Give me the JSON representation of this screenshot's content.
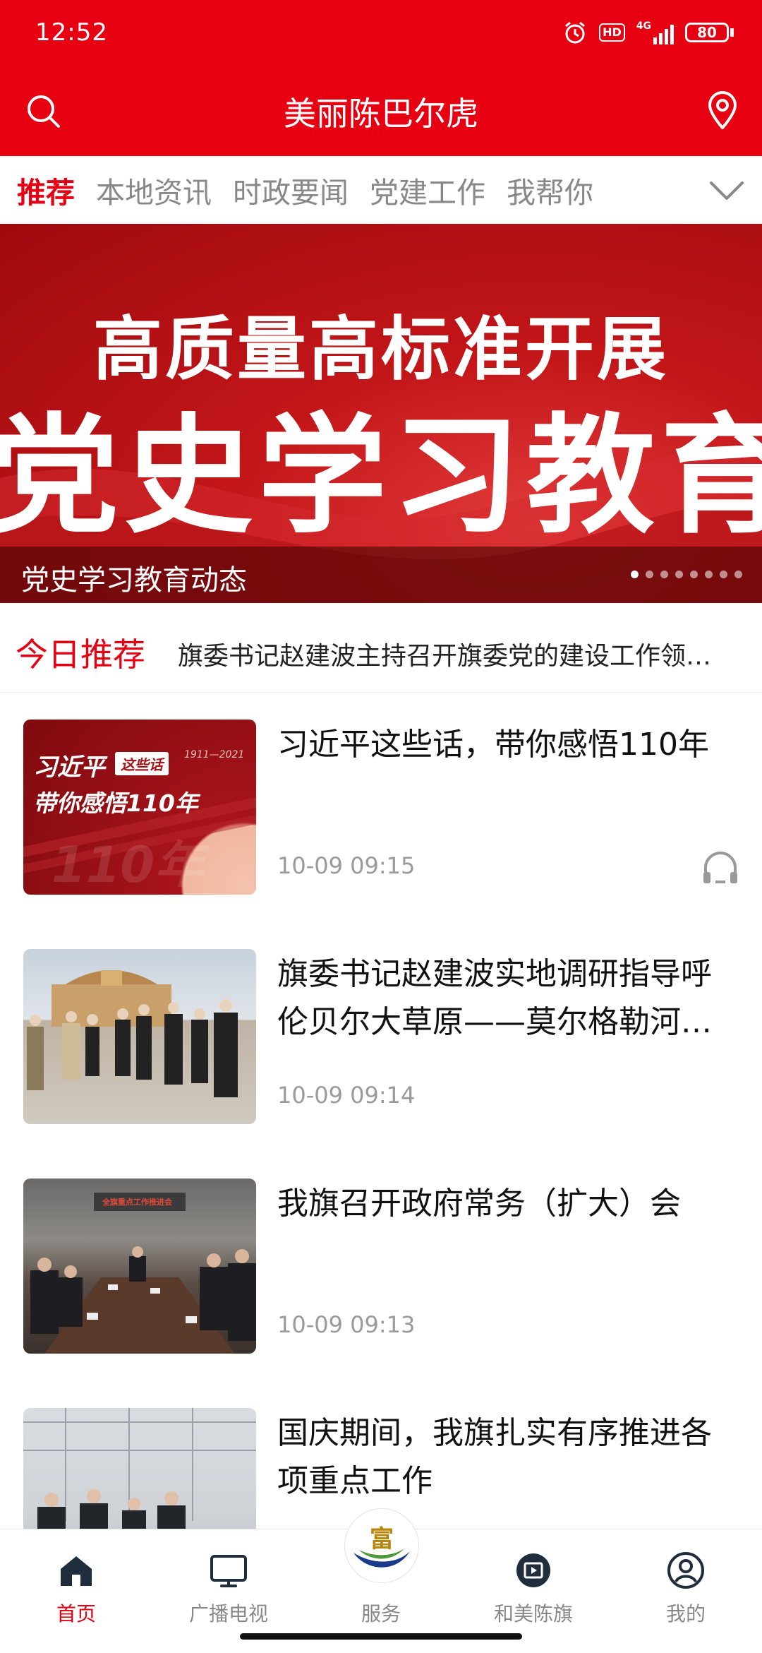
{
  "status_bar": {
    "time": "12:52",
    "network": "4G",
    "hd": "HD",
    "battery": "80"
  },
  "header": {
    "title": "美丽陈巴尔虎"
  },
  "tabs": [
    {
      "label": "推荐",
      "active": true
    },
    {
      "label": "本地资讯",
      "active": false
    },
    {
      "label": "时政要闻",
      "active": false
    },
    {
      "label": "党建工作",
      "active": false
    },
    {
      "label": "我帮你",
      "active": false
    }
  ],
  "banner": {
    "line1": "高质量高标准开展",
    "line2": "党史学习教育",
    "caption": "党史学习教育动态",
    "slide_count": 8,
    "active_slide": 1
  },
  "today": {
    "label": "今日推荐",
    "headline": "旗委书记赵建波主持召开旗委党的建设工作领导小组会议"
  },
  "news": [
    {
      "title": "习近平这些话，带你感悟110年",
      "time": "10-09 09:15",
      "audio": true,
      "thumb_text_1": "习近平",
      "thumb_tag": "这些话",
      "thumb_text_2": "带你感悟110年",
      "thumb_years": "1911—2021",
      "thumb_big": "110年"
    },
    {
      "title": "旗委书记赵建波实地调研指导呼伦贝尔大草原——莫尔格勒河…",
      "time": "10-09 09:14",
      "audio": false
    },
    {
      "title": "我旗召开政府常务（扩大）会",
      "time": "10-09 09:13",
      "audio": false,
      "thumb_banner": "全旗重点工作推进会"
    },
    {
      "title": "国庆期间，我旗扎实有序推进各项重点工作",
      "time": "",
      "audio": false
    }
  ],
  "bottom_nav": [
    {
      "label": "首页",
      "icon": "home-icon",
      "active": true
    },
    {
      "label": "广播电视",
      "icon": "tv-icon",
      "active": false
    },
    {
      "label": "服务",
      "icon": "service-logo-icon",
      "active": false
    },
    {
      "label": "和美陈旗",
      "icon": "video-icon",
      "active": false
    },
    {
      "label": "我的",
      "icon": "user-icon",
      "active": false
    }
  ],
  "colors": {
    "brand": "#E60012",
    "text": "#111111",
    "muted": "#9A9A9A"
  }
}
